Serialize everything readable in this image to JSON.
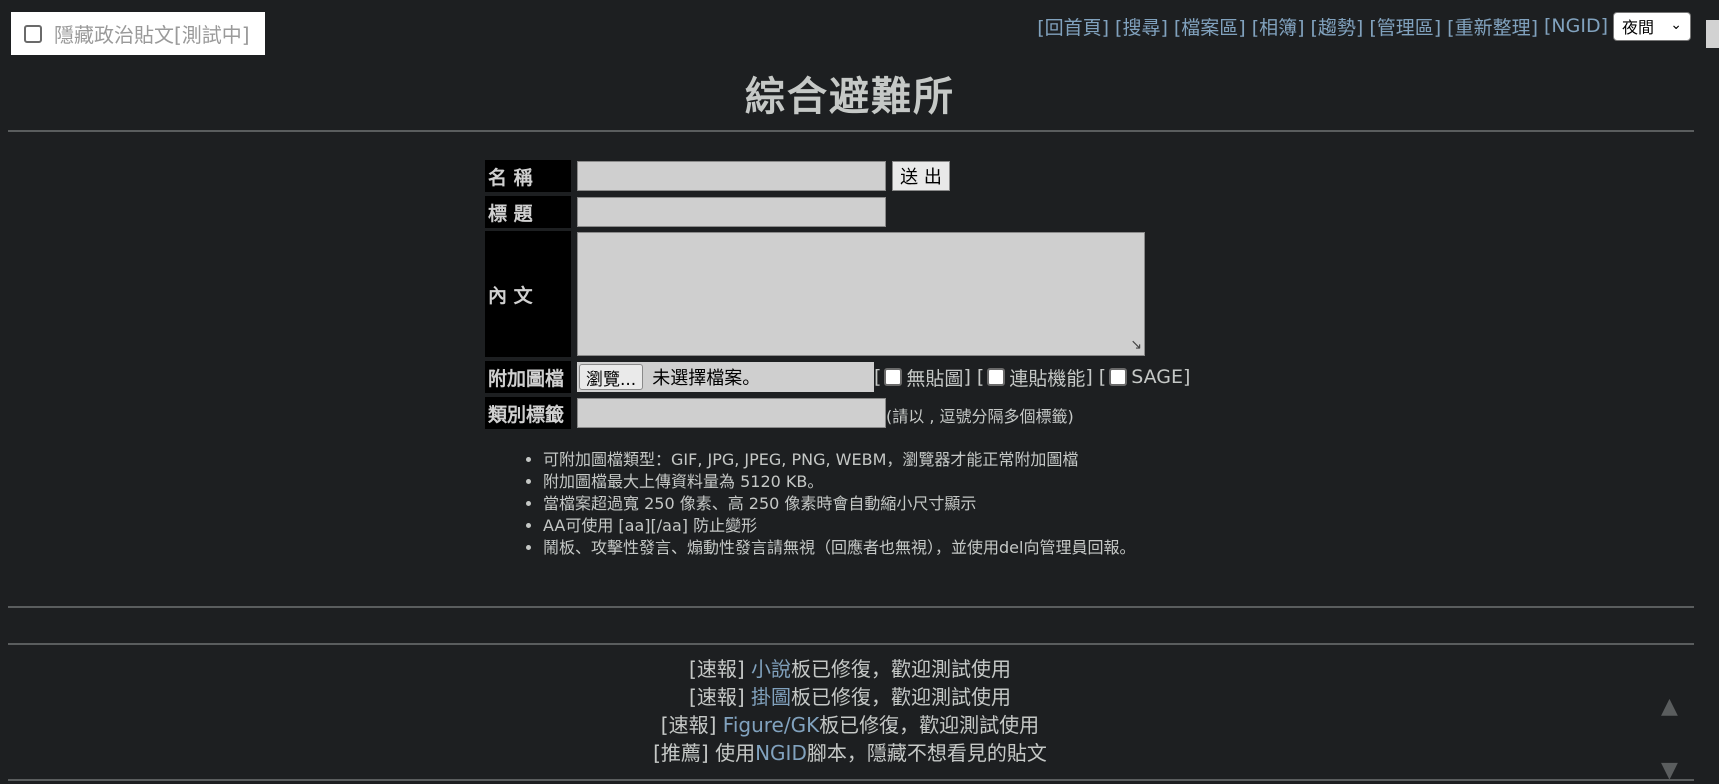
{
  "hide_toggle": {
    "label": "隱藏政治貼文[測試中]"
  },
  "nav": {
    "items": [
      "[回首頁]",
      "[搜尋]",
      "[檔案區]",
      "[相簿]",
      "[趨勢]",
      "[管理區]",
      "[重新整理]",
      "[NGID]"
    ],
    "theme_select": "夜間"
  },
  "page_title": "綜合避難所",
  "form": {
    "name_label": "名 稱",
    "submit_label": "送 出",
    "subject_label": "標 題",
    "content_label": "內 文",
    "attach_label": "附加圖檔",
    "browse_label": "瀏覽...",
    "no_file_label": "未選擇檔案。",
    "options": [
      {
        "label": "無貼圖",
        "checked": false
      },
      {
        "label": "連貼機能",
        "checked": false
      },
      {
        "label": "SAGE",
        "checked": false
      }
    ],
    "tags_label": "類別標籤",
    "tags_hint": "(請以 , 逗號分隔多個標籤)"
  },
  "rules": [
    "可附加圖檔類型：GIF, JPG, JPEG, PNG, WEBM，瀏覽器才能正常附加圖檔",
    "附加圖檔最大上傳資料量為 5120 KB。",
    "當檔案超過寬 250 像素、高 250 像素時會自動縮小尺寸顯示",
    "AA可使用 [aa][/aa] 防止變形",
    "鬧板、攻擊性發言、煽動性發言請無視（回應者也無視），並使用del向管理員回報。"
  ],
  "news": [
    {
      "prefix": "[速報] ",
      "link": "小說",
      "suffix": "板已修復，歡迎測試使用"
    },
    {
      "prefix": "[速報] ",
      "link": "掛圖",
      "suffix": "板已修復，歡迎測試使用"
    },
    {
      "prefix": "[速報] ",
      "link": "Figure/GK",
      "suffix": "板已修復，歡迎測試使用"
    },
    {
      "prefix": "[推薦] 使用",
      "link": "NGID",
      "suffix": "腳本，隱藏不想看見的貼文"
    }
  ],
  "colors": {
    "background": "#1d1f21",
    "text": "#c5c8c6",
    "link": "#81a2be"
  }
}
